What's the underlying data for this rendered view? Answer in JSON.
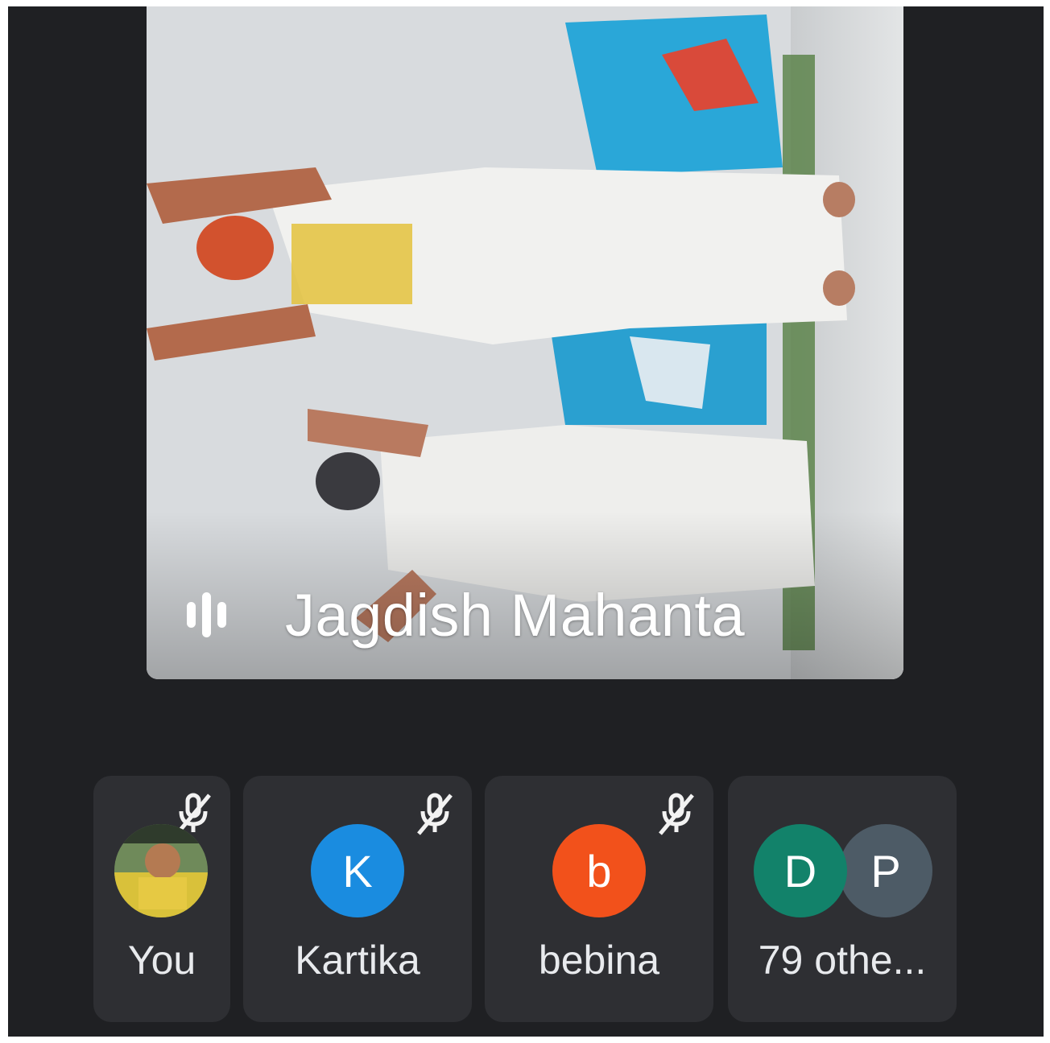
{
  "main_speaker": {
    "name": "Jagdish Mahanta",
    "audio_icon": "audio-level-icon"
  },
  "participants": [
    {
      "name": "You",
      "avatar_type": "photo",
      "muted": true
    },
    {
      "name": "Kartika",
      "initial": "K",
      "avatar_color": "#1a8ce0",
      "muted": true
    },
    {
      "name": "bebina",
      "initial": "b",
      "avatar_color": "#f2511b",
      "muted": true
    }
  ],
  "others": {
    "label": "79 othe...",
    "initials": [
      "D",
      "P"
    ],
    "colors": [
      "#12826a",
      "#4d5b66"
    ]
  },
  "colors": {
    "background": "#1f2023",
    "tile": "#2e2f33",
    "text": "#e8eaed"
  }
}
